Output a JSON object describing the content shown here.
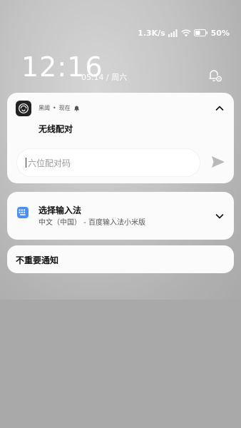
{
  "status": {
    "net_speed": "1.3K/s",
    "battery": "50%",
    "battery_level": 0.5
  },
  "lockscreen": {
    "time": "12:16",
    "date": "05.14 / 周六"
  },
  "notifications": [
    {
      "app_name": "黑阈",
      "sep": "•",
      "time": "现在",
      "title": "无线配对",
      "reply_placeholder": "六位配对码"
    },
    {
      "title": "选择输入法",
      "subtitle": "中文（中国） - 百度输入法小米版"
    },
    {
      "title": "不重要通知"
    }
  ],
  "icons": {
    "app": "black-threshold-app-icon",
    "bell": "bell-icon",
    "keyboard": "keyboard-icon",
    "send": "send-icon",
    "settings": "notification-settings-icon"
  }
}
